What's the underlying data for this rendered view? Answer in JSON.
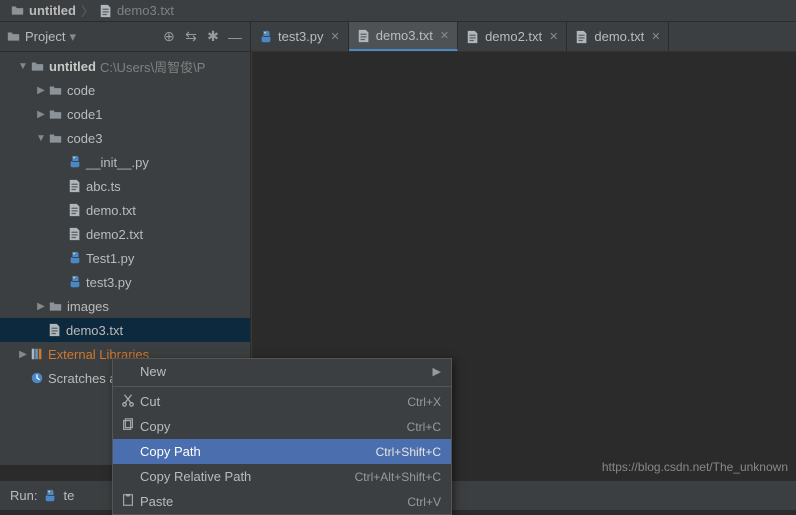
{
  "breadcrumb": {
    "root": "untitled",
    "file": "demo3.txt"
  },
  "panel": {
    "title": "Project",
    "buttons": {
      "target": "⊕",
      "collapse": "⇆",
      "settings": "✱",
      "hide": "—"
    }
  },
  "tree": {
    "root": {
      "name": "untitled",
      "path": "C:\\Users\\周智俊\\P"
    },
    "code": "code",
    "code1": "code1",
    "code3": "code3",
    "init": "__init__.py",
    "abc": "abc.ts",
    "demo": "demo.txt",
    "demo2": "demo2.txt",
    "test1": "Test1.py",
    "test3": "test3.py",
    "images": "images",
    "demo3": "demo3.txt",
    "external": "External Libraries",
    "scratch": "Scratches and Consoles"
  },
  "tabs": [
    {
      "label": "test3.py",
      "type": "py",
      "active": false
    },
    {
      "label": "demo3.txt",
      "type": "txt",
      "active": true
    },
    {
      "label": "demo2.txt",
      "type": "txt",
      "active": false
    },
    {
      "label": "demo.txt",
      "type": "txt",
      "active": false
    }
  ],
  "context_menu": {
    "new": "New",
    "cut": {
      "label": "Cut",
      "shortcut": "Ctrl+X"
    },
    "copy": {
      "label": "Copy",
      "shortcut": "Ctrl+C"
    },
    "copy_path": {
      "label": "Copy Path",
      "shortcut": "Ctrl+Shift+C"
    },
    "copy_rel": {
      "label": "Copy Relative Path",
      "shortcut": "Ctrl+Alt+Shift+C"
    },
    "paste": {
      "label": "Paste",
      "shortcut": "Ctrl+V"
    }
  },
  "bottom": {
    "run_label": "Run:",
    "run_config": "te"
  },
  "watermark": "https://blog.csdn.net/The_unknown"
}
